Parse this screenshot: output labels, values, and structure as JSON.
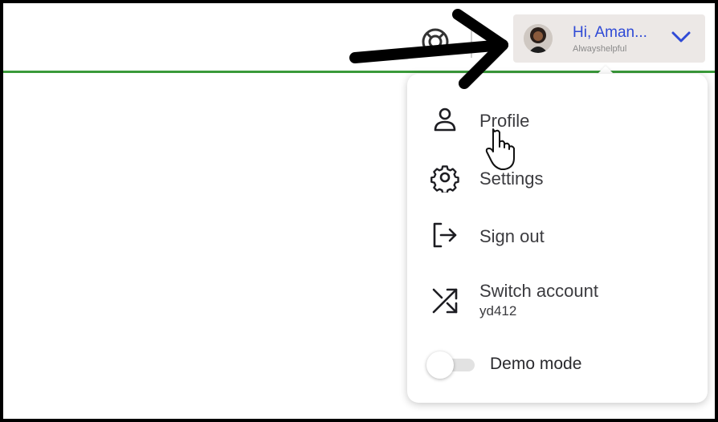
{
  "header": {
    "help_icon": "lifebuoy-icon",
    "user": {
      "greeting": "Hi, Aman...",
      "subtitle": "Alwayshelpful",
      "chevron_icon": "chevron-down-icon",
      "greeting_color": "#2f4ad6"
    },
    "accent_line_color": "#3a9a3a"
  },
  "menu": {
    "items": [
      {
        "label": "Profile",
        "icon": "user-icon"
      },
      {
        "label": "Settings",
        "icon": "gear-icon"
      },
      {
        "label": "Sign out",
        "icon": "sign-out-icon"
      },
      {
        "label": "Switch account",
        "sub": "yd412",
        "icon": "shuffle-icon"
      }
    ],
    "demo_mode": {
      "label": "Demo mode",
      "enabled": false
    }
  },
  "annotation": {
    "arrow_icon": "pointer-arrow-icon",
    "cursor_icon": "hand-cursor-icon"
  }
}
